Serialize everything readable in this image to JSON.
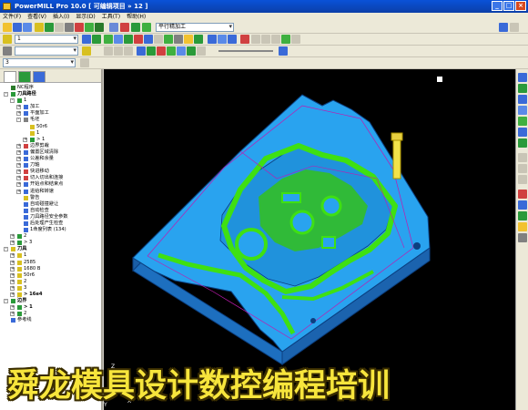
{
  "window": {
    "title": "PowerMILL Pro 10.0    [ 可编辑项目 » 12 ]",
    "controls": [
      "_",
      "□",
      "×"
    ]
  },
  "menu": [
    "文件(F)",
    "查看(V)",
    "插入(I)",
    "显示(D)",
    "工具(T)",
    "帮助(H)"
  ],
  "toolbar": {
    "tool_combo": "1",
    "strategy_combo": "平行精加工",
    "layer_combo": "3"
  },
  "explorer": {
    "items": [
      {
        "label": "NC程序",
        "level": 0,
        "bold": false,
        "expand": "",
        "icon": "#2a7a2a"
      },
      {
        "label": "刀具路径",
        "level": 0,
        "bold": true,
        "expand": "-",
        "icon": "#2a9a3a"
      },
      {
        "label": "1",
        "level": 1,
        "bold": false,
        "expand": "-",
        "icon": "#2a9a3a"
      },
      {
        "label": "加工",
        "level": 2,
        "bold": false,
        "expand": "+",
        "icon": "#3a6ad8"
      },
      {
        "label": "平面加工",
        "level": 2,
        "bold": false,
        "expand": "+",
        "icon": "#3a6ad8"
      },
      {
        "label": "毛坯",
        "level": 2,
        "bold": false,
        "expand": "-",
        "icon": "#808080"
      },
      {
        "label": "50r6",
        "level": 3,
        "bold": false,
        "expand": "",
        "icon": "#d8c020"
      },
      {
        "label": "1",
        "level": 3,
        "bold": false,
        "expand": "",
        "icon": "#d8c020"
      },
      {
        "label": "> 1",
        "level": 3,
        "bold": false,
        "expand": "+",
        "icon": "#2a9a3a"
      },
      {
        "label": "边界剪裁",
        "level": 2,
        "bold": false,
        "expand": "+",
        "icon": "#d04040"
      },
      {
        "label": "偏置区域清除",
        "level": 2,
        "bold": false,
        "expand": "+",
        "icon": "#3a6ad8"
      },
      {
        "label": "公差和余量",
        "level": 2,
        "bold": false,
        "expand": "+",
        "icon": "#3a6ad8"
      },
      {
        "label": "刀轴",
        "level": 2,
        "bold": false,
        "expand": "+",
        "icon": "#3a6ad8"
      },
      {
        "label": "快进移动",
        "level": 2,
        "bold": false,
        "expand": "+",
        "icon": "#d04040"
      },
      {
        "label": "切入切出和连接",
        "level": 2,
        "bold": false,
        "expand": "+",
        "icon": "#d04040"
      },
      {
        "label": "开始点和结束点",
        "level": 2,
        "bold": false,
        "expand": "+",
        "icon": "#3a6ad8"
      },
      {
        "label": "进给和转速",
        "level": 2,
        "bold": false,
        "expand": "+",
        "icon": "#3a6ad8"
      },
      {
        "label": "警告",
        "level": 2,
        "bold": false,
        "expand": "",
        "icon": "#d8c020"
      },
      {
        "label": "自动碰撞避让",
        "level": 2,
        "bold": false,
        "expand": "",
        "icon": "#3a6ad8"
      },
      {
        "label": "自动检查",
        "level": 2,
        "bold": false,
        "expand": "",
        "icon": "#3a6ad8"
      },
      {
        "label": "刀具路径安全参数",
        "level": 2,
        "bold": false,
        "expand": "",
        "icon": "#3a6ad8"
      },
      {
        "label": "后处理产生检查",
        "level": 2,
        "bold": false,
        "expand": "",
        "icon": "#3a6ad8"
      },
      {
        "label": "1命度列表 (134)",
        "level": 2,
        "bold": false,
        "expand": "",
        "icon": "#3a6ad8"
      },
      {
        "label": "2",
        "level": 1,
        "bold": false,
        "expand": "+",
        "icon": "#2a9a3a"
      },
      {
        "label": "> 3",
        "level": 1,
        "bold": false,
        "expand": "+",
        "icon": "#2a9a3a"
      },
      {
        "label": "刀具",
        "level": 0,
        "bold": true,
        "expand": "-",
        "icon": "#d8c020"
      },
      {
        "label": "1",
        "level": 1,
        "bold": false,
        "expand": "+",
        "icon": "#d8c020"
      },
      {
        "label": "2585",
        "level": 1,
        "bold": false,
        "expand": "+",
        "icon": "#d8c020"
      },
      {
        "label": "1680 B",
        "level": 1,
        "bold": false,
        "expand": "+",
        "icon": "#d8c020"
      },
      {
        "label": "50r6",
        "level": 1,
        "bold": false,
        "expand": "+",
        "icon": "#d8c020"
      },
      {
        "label": "2",
        "level": 1,
        "bold": false,
        "expand": "+",
        "icon": "#d8c020"
      },
      {
        "label": "3",
        "level": 1,
        "bold": false,
        "expand": "+",
        "icon": "#d8c020"
      },
      {
        "label": "> 16e4",
        "level": 1,
        "bold": true,
        "expand": "+",
        "icon": "#d8c020"
      },
      {
        "label": "边界",
        "level": 0,
        "bold": true,
        "expand": "-",
        "icon": "#2a9a3a"
      },
      {
        "label": "> 1",
        "level": 1,
        "bold": true,
        "expand": "+",
        "icon": "#2a9a3a"
      },
      {
        "label": "2",
        "level": 1,
        "bold": false,
        "expand": "+",
        "icon": "#2a9a3a"
      },
      {
        "label": "参考线",
        "level": 0,
        "bold": false,
        "expand": "",
        "icon": "#3a6ad8"
      }
    ]
  },
  "viewport": {
    "axis_labels": {
      "x": "X",
      "y": "Y",
      "z": "Z"
    }
  },
  "banner": {
    "text": "舜龙模具设计数控编程培训"
  },
  "colors": {
    "part_top": "#29a3ef",
    "part_side": "#1d6fbf",
    "part_edge": "#0b3f80",
    "toolpath": "#3fe012",
    "banner_text": "#f7e53c"
  }
}
